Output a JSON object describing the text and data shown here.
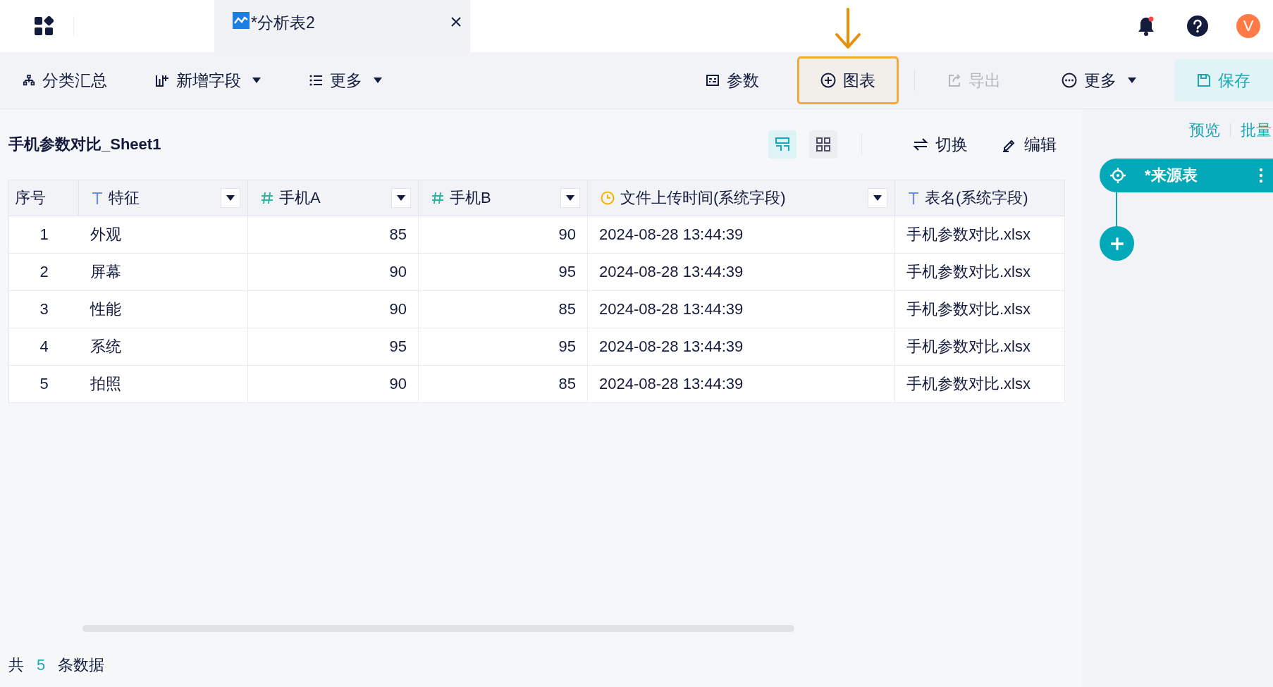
{
  "top_bar": {
    "tabs": [
      {
        "title": "*分析表2",
        "selected": true
      }
    ],
    "notifications_unread": true,
    "avatar": "V"
  },
  "toolbar": {
    "left": [
      {
        "label": "分类汇总",
        "dropdown": false
      },
      {
        "label": "新增字段",
        "dropdown": true
      },
      {
        "label": "更多",
        "dropdown": true
      }
    ],
    "right": [
      {
        "label": "参数",
        "dropdown": false,
        "disabled": false,
        "highlighted": false,
        "primary": false
      },
      {
        "label": "图表",
        "dropdown": false,
        "disabled": false,
        "highlighted": true,
        "primary": false
      },
      {
        "label": "导出",
        "dropdown": false,
        "disabled": true,
        "highlighted": false,
        "primary": false
      },
      {
        "label": "更多",
        "dropdown": true,
        "disabled": false,
        "highlighted": false,
        "primary": false
      },
      {
        "label": "保存",
        "dropdown": false,
        "disabled": false,
        "highlighted": false,
        "primary": true
      }
    ]
  },
  "sheet": {
    "title": "手机参数对比_Sheet1",
    "views": [
      {
        "selected": true
      },
      {
        "selected": false
      }
    ],
    "actions": [
      {
        "label": "切换"
      },
      {
        "label": "编辑"
      }
    ]
  },
  "table": {
    "columns": [
      {
        "label": "序号",
        "kind": "index",
        "filter": false
      },
      {
        "label": "特征",
        "kind": "text",
        "filter": true
      },
      {
        "label": "手机A",
        "kind": "number",
        "filter": true
      },
      {
        "label": "手机B",
        "kind": "number",
        "filter": true
      },
      {
        "label": "文件上传时间(系统字段)",
        "kind": "time",
        "filter": true
      },
      {
        "label": "表名(系统字段)",
        "kind": "text",
        "filter": false
      }
    ],
    "rows": [
      [
        "1",
        "外观",
        "85",
        "90",
        "2024-08-28 13:44:39",
        "手机参数对比.xlsx"
      ],
      [
        "2",
        "屏幕",
        "90",
        "95",
        "2024-08-28 13:44:39",
        "手机参数对比.xlsx"
      ],
      [
        "3",
        "性能",
        "90",
        "85",
        "2024-08-28 13:44:39",
        "手机参数对比.xlsx"
      ],
      [
        "4",
        "系统",
        "95",
        "95",
        "2024-08-28 13:44:39",
        "手机参数对比.xlsx"
      ],
      [
        "5",
        "拍照",
        "90",
        "85",
        "2024-08-28 13:44:39",
        "手机参数对比.xlsx"
      ]
    ]
  },
  "footer": {
    "prefix": "共",
    "count": "5",
    "suffix": "条数据"
  },
  "flow_panel": {
    "links": [
      "预览",
      "批量"
    ],
    "node": {
      "title": "*来源表"
    }
  }
}
